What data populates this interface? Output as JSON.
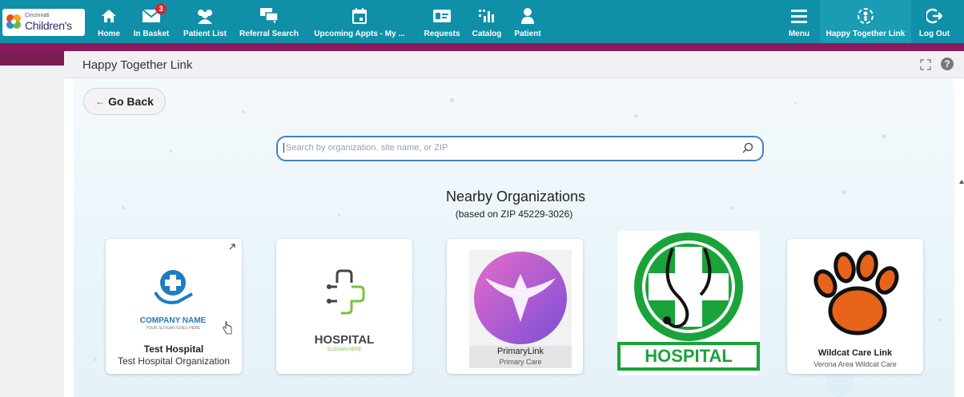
{
  "topbar": {
    "logo": {
      "line1": "Cincinnati",
      "line2": "Children's"
    },
    "nav": [
      {
        "label": "Home",
        "icon": "home-icon"
      },
      {
        "label": "In Basket",
        "icon": "envelope-icon",
        "badge": "3"
      },
      {
        "label": "Patient List",
        "icon": "people-icon"
      },
      {
        "label": "Referral Search",
        "icon": "chat-icon"
      },
      {
        "label": "Upcoming Appts - My ...",
        "icon": "calendar-icon"
      },
      {
        "label": "Requests",
        "icon": "id-card-icon"
      },
      {
        "label": "Catalog",
        "icon": "catalog-icon"
      },
      {
        "label": "Patient",
        "icon": "person-icon"
      }
    ],
    "right": [
      {
        "label": "Menu",
        "icon": "menu-icon"
      },
      {
        "label": "Happy Together Link",
        "icon": "link-person-icon"
      },
      {
        "label": "Log Out",
        "icon": "logout-icon"
      }
    ]
  },
  "page": {
    "title": "Happy Together Link",
    "help": "?",
    "go_back": "Go Back",
    "search_placeholder": "Search by organization, site name, or ZIP",
    "heading": "Nearby Organizations",
    "subheading": "(based on ZIP 45229-3026)"
  },
  "cards": [
    {
      "name": "Test Hospital",
      "sub": "Test Hospital Organization",
      "logo_text": "COMPANY NAME",
      "logo_slogan": "YOUR SLOGAN GOES HERE"
    },
    {
      "name": "",
      "sub": "",
      "logo_text": "HOSPITAL",
      "logo_slogan": "SLOGAN HERE"
    },
    {
      "name": "PrimaryLink",
      "sub": "Primary Care"
    },
    {
      "name": "",
      "sub": "",
      "logo_text": "HOSPITAL"
    },
    {
      "name": "Wildcat Care Link",
      "sub": "Verona Area Wildcat Care"
    }
  ],
  "colors": {
    "topbar": "#0f8fa8",
    "accent_bar": "#8b1a5c",
    "search_border": "#3f82c2",
    "hospital_green": "#1aa33a"
  }
}
